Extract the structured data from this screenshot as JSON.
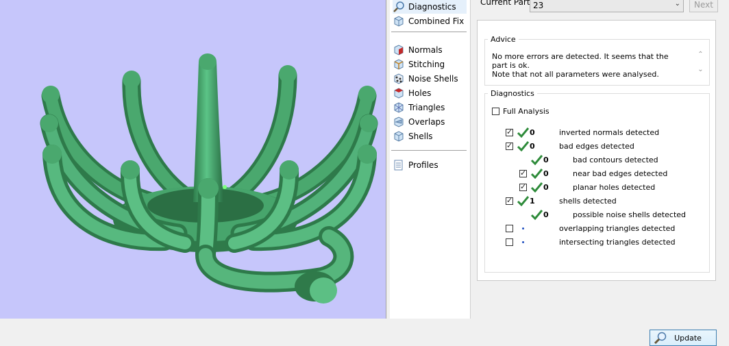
{
  "nav": {
    "items": [
      {
        "label": "Diagnostics",
        "icon": "magnifier-icon",
        "selected": true
      },
      {
        "label": "Combined Fix",
        "icon": "cube-icon"
      },
      {
        "label": "Normals",
        "icon": "normals-cube-icon"
      },
      {
        "label": "Stitching",
        "icon": "stitching-cube-icon"
      },
      {
        "label": "Noise Shells",
        "icon": "noise-shells-icon"
      },
      {
        "label": "Holes",
        "icon": "holes-cube-icon"
      },
      {
        "label": "Triangles",
        "icon": "triangles-cube-icon"
      },
      {
        "label": "Overlaps",
        "icon": "overlaps-cube-icon"
      },
      {
        "label": "Shells",
        "icon": "shells-cube-icon"
      },
      {
        "label": "Profiles",
        "icon": "profiles-icon"
      }
    ]
  },
  "header": {
    "current_part_label": "Current Part:",
    "current_part_value": "23",
    "next_label": "Next"
  },
  "advice": {
    "title": "Advice",
    "line1": "No more errors are detected. It seems that the part is ok.",
    "line2": "Note that not all parameters were analysed."
  },
  "diagnostics": {
    "title": "Diagnostics",
    "full_analysis_label": "Full Analysis",
    "full_analysis_checked": false,
    "rows": [
      {
        "checked": true,
        "status": "ok",
        "count": "0",
        "text": "inverted normals detected"
      },
      {
        "checked": true,
        "status": "ok",
        "count": "0",
        "text": "bad edges detected"
      },
      {
        "checked": null,
        "status": "ok",
        "count": "0",
        "text": "bad contours detected"
      },
      {
        "checked": true,
        "status": "ok",
        "count": "0",
        "text": "near bad edges detected"
      },
      {
        "checked": true,
        "status": "ok",
        "count": "0",
        "text": "planar holes detected"
      },
      {
        "checked": true,
        "status": "ok",
        "count": "1",
        "text": "shells detected"
      },
      {
        "checked": null,
        "status": "ok",
        "count": "0",
        "text": "possible noise shells detected"
      },
      {
        "checked": false,
        "status": "pending",
        "count": "",
        "text": "overlapping triangles detected"
      },
      {
        "checked": false,
        "status": "pending",
        "count": "",
        "text": "intersecting triangles detected"
      }
    ],
    "update_label": "Update"
  },
  "colors": {
    "viewport_bg": "#c6c6fb",
    "model_green": "#3f9a62",
    "ok_tick": "#2e8b3a",
    "accent": "#3c7fb1"
  }
}
